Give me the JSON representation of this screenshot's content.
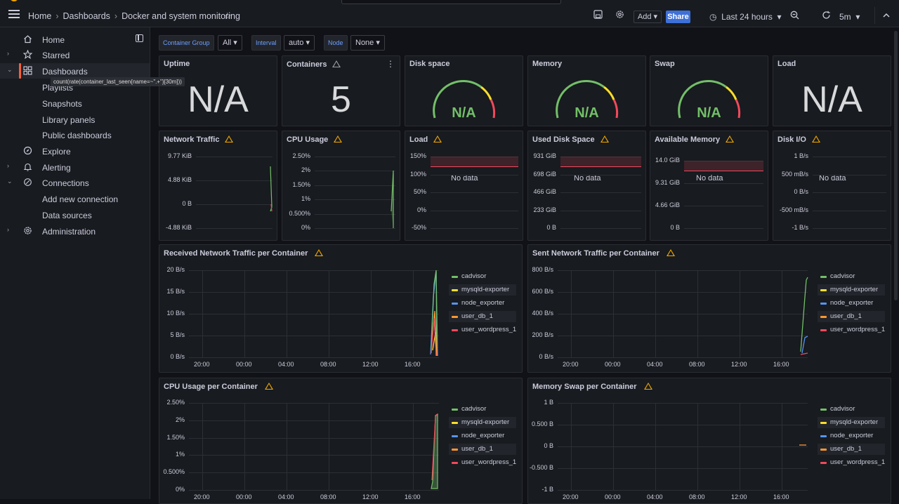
{
  "topbar": {
    "breadcrumbs": [
      "Home",
      "Dashboards",
      "Docker and system monitoring"
    ],
    "add_label": "Add",
    "share_label": "Share",
    "time_range": "Last 24 hours",
    "refresh_interval": "5m"
  },
  "sidebar": {
    "items": [
      {
        "label": "Home"
      },
      {
        "label": "Starred"
      },
      {
        "label": "Dashboards"
      },
      {
        "label": "Playlists"
      },
      {
        "label": "Snapshots"
      },
      {
        "label": "Library panels"
      },
      {
        "label": "Public dashboards"
      },
      {
        "label": "Explore"
      },
      {
        "label": "Alerting"
      },
      {
        "label": "Connections"
      },
      {
        "label": "Add new connection"
      },
      {
        "label": "Data sources"
      },
      {
        "label": "Administration"
      }
    ],
    "tooltip": "count(rate(container_last_seen{name=~\".+\"}[30m]))"
  },
  "variables": {
    "container_group_label": "Container Group",
    "container_group_value": "All",
    "interval_label": "Interval",
    "interval_value": "auto",
    "node_label": "Node",
    "node_value": "None"
  },
  "stats": {
    "uptime": {
      "title": "Uptime",
      "value": "N/A"
    },
    "containers": {
      "title": "Containers",
      "value": "5"
    },
    "disk_space": {
      "title": "Disk space",
      "value": "N/A"
    },
    "memory": {
      "title": "Memory",
      "value": "N/A"
    },
    "swap": {
      "title": "Swap",
      "value": "N/A"
    },
    "load": {
      "title": "Load",
      "value": "N/A"
    }
  },
  "small_panels": {
    "network_traffic": {
      "title": "Network Traffic",
      "yticks": [
        "9.77 KiB",
        "4.88 KiB",
        "0 B",
        "-4.88 KiB"
      ]
    },
    "cpu_usage": {
      "title": "CPU Usage",
      "yticks": [
        "2.50%",
        "2%",
        "1.50%",
        "1%",
        "0.500%",
        "0%"
      ]
    },
    "load": {
      "title": "Load",
      "yticks": [
        "150%",
        "100%",
        "50%",
        "0%",
        "-50%"
      ],
      "nodata": "No data"
    },
    "used_disk_space": {
      "title": "Used Disk Space",
      "yticks": [
        "931 GiB",
        "698 GiB",
        "466 GiB",
        "233 GiB",
        "0 B"
      ],
      "nodata": "No data"
    },
    "available_memory": {
      "title": "Available Memory",
      "yticks": [
        "14.0 GiB",
        "9.31 GiB",
        "4.66 GiB",
        "0 B"
      ],
      "nodata": "No data"
    },
    "disk_io": {
      "title": "Disk I/O",
      "yticks": [
        "1 B/s",
        "500 mB/s",
        "0 B/s",
        "-500 mB/s",
        "-1 B/s"
      ],
      "nodata": "No data"
    }
  },
  "legend": [
    "cadvisor",
    "mysqld-exporter",
    "node_exporter",
    "user_db_1",
    "user_wordpress_1"
  ],
  "colors": {
    "cadvisor": "#73bf69",
    "mysqld-exporter": "#fade2a",
    "node_exporter": "#5794f2",
    "user_db_1": "#ff9830",
    "user_wordpress_1": "#f2495c",
    "threshold": "#f2495c",
    "accent": "#3d71d9"
  },
  "xticks": [
    "20:00",
    "00:00",
    "04:00",
    "08:00",
    "12:00",
    "16:00"
  ],
  "big_panels": {
    "received": {
      "title": "Received Network Traffic per Container",
      "yticks": [
        "20 B/s",
        "15 B/s",
        "10 B/s",
        "5 B/s",
        "0 B/s"
      ]
    },
    "sent": {
      "title": "Sent Network Traffic per Container",
      "yticks": [
        "800 B/s",
        "600 B/s",
        "400 B/s",
        "200 B/s",
        "0 B/s"
      ]
    },
    "cpu": {
      "title": "CPU Usage per Container",
      "yticks": [
        "2.50%",
        "2%",
        "1.50%",
        "1%",
        "0.500%",
        "0%"
      ]
    },
    "swap": {
      "title": "Memory Swap per Container",
      "yticks": [
        "1 B",
        "0.500 B",
        "0 B",
        "-0.500 B",
        "-1 B"
      ]
    }
  }
}
